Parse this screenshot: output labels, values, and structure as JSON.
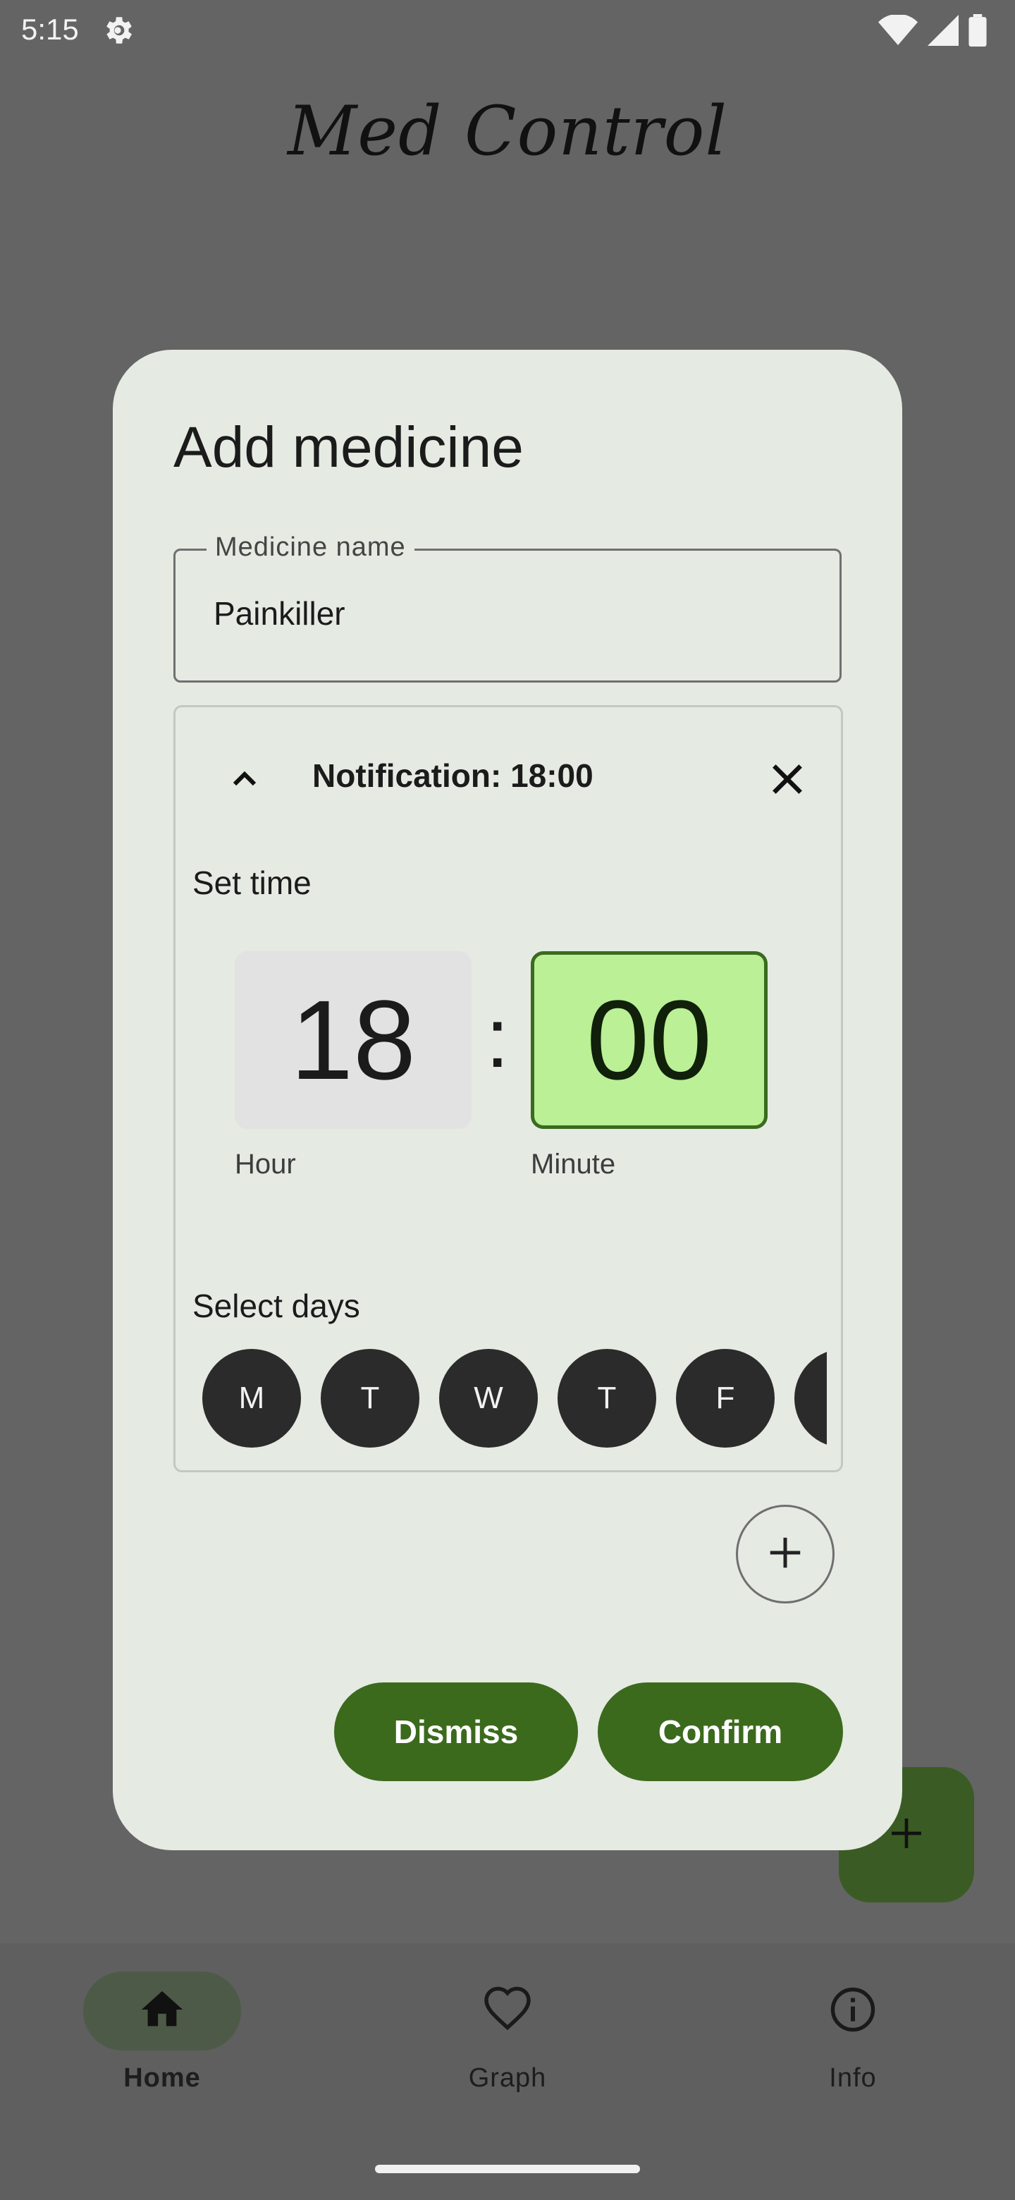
{
  "status_bar": {
    "time": "5:15"
  },
  "app": {
    "title": "Med Control"
  },
  "dialog": {
    "title": "Add medicine",
    "medicine_name": {
      "label": "Medicine name",
      "value": "Painkiller"
    },
    "notification": {
      "title": "Notification: 18:00",
      "set_time_label": "Set time",
      "hour": "18",
      "separator": ":",
      "minute": "00",
      "hour_label": "Hour",
      "minute_label": "Minute",
      "select_days_label": "Select days",
      "days": [
        "M",
        "T",
        "W",
        "T",
        "F",
        ""
      ]
    },
    "dismiss_label": "Dismiss",
    "confirm_label": "Confirm"
  },
  "bottom_nav": {
    "items": [
      {
        "label": "Home",
        "icon": "home-icon",
        "active": true
      },
      {
        "label": "Graph",
        "icon": "heart-icon",
        "active": false
      },
      {
        "label": "Info",
        "icon": "info-icon",
        "active": false
      }
    ]
  },
  "colors": {
    "scrim": "#646464",
    "dialog_bg": "#e5eae3",
    "accent": "#3b6a1c",
    "minute_highlight": "#bbf096"
  }
}
